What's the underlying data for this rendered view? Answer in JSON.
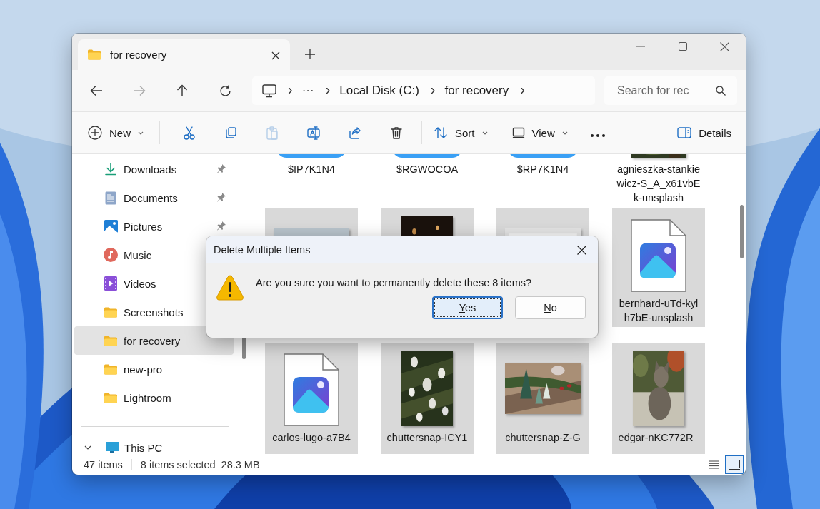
{
  "tab": {
    "title": "for recovery",
    "selected": true
  },
  "address": {
    "items": [
      {
        "kind": "separator",
        "text": "›"
      },
      {
        "kind": "crumb",
        "text": "···"
      },
      {
        "kind": "separator",
        "text": "›"
      },
      {
        "kind": "crumb",
        "text": "Local Disk (C:)"
      },
      {
        "kind": "separator",
        "text": "›"
      },
      {
        "kind": "crumb",
        "text": "for recovery"
      },
      {
        "kind": "separator",
        "text": "›"
      }
    ]
  },
  "search": {
    "placeholder": "Search for rec"
  },
  "toolbar": {
    "new": {
      "label": "New"
    },
    "actions": [
      {
        "disabled": false
      },
      {
        "disabled": false
      },
      {
        "disabled": true
      },
      {
        "disabled": false
      },
      {
        "disabled": false
      },
      {
        "disabled": false
      }
    ],
    "menus": [
      {
        "label": "Sort"
      },
      {
        "label": "View"
      }
    ],
    "details": {
      "label": "Details"
    }
  },
  "sidebar": {
    "items": [
      {
        "label": "Downloads",
        "pinned": true,
        "selected": false
      },
      {
        "label": "Documents",
        "pinned": true,
        "selected": false
      },
      {
        "label": "Pictures",
        "pinned": true,
        "selected": false
      },
      {
        "label": "Music",
        "pinned": false,
        "selected": false
      },
      {
        "label": "Videos",
        "pinned": false,
        "selected": false
      },
      {
        "label": "Screenshots",
        "pinned": false,
        "selected": false
      },
      {
        "label": "for recovery",
        "pinned": false,
        "selected": true
      },
      {
        "label": "new-pro",
        "pinned": false,
        "selected": false
      },
      {
        "label": "Lightroom",
        "pinned": false,
        "selected": false
      }
    ],
    "this_pc": {
      "label": "This PC",
      "expanded": true
    }
  },
  "files": [
    {
      "kind": "app",
      "name": "$IP7K1N4",
      "selected": false
    },
    {
      "kind": "app",
      "name": "$RGWOCOA",
      "selected": false
    },
    {
      "kind": "app",
      "name": "$RP7K1N4",
      "selected": false
    },
    {
      "kind": "picture",
      "name": "agnieszka-stankiewicz-S_A_x61vbEk-unsplash",
      "selected": false
    },
    {
      "kind": "picture",
      "selected": true
    },
    {
      "kind": "picture",
      "selected": true
    },
    {
      "kind": "picture",
      "selected": true
    },
    {
      "kind": "image-file",
      "name": "bernhard-uTd-kylh7bE-unsplash",
      "selected": true
    },
    {
      "kind": "image-file",
      "name": "carlos-lugo-a7B4",
      "selected": true
    },
    {
      "kind": "picture",
      "name": "chuttersnap-ICY1",
      "selected": true
    },
    {
      "kind": "picture",
      "name": "chuttersnap-Z-G",
      "selected": true
    },
    {
      "kind": "picture",
      "name": "edgar-nKC772R_",
      "selected": true
    }
  ],
  "status": {
    "count": "47 items",
    "selection": "8 items selected",
    "size": "28.3 MB",
    "views": [
      {
        "selected": false
      },
      {
        "selected": true
      }
    ]
  },
  "dialog": {
    "title": "Delete Multiple Items",
    "message": "Are you sure you want to permanently delete these 8 items?",
    "buttons": [
      {
        "label": "Yes",
        "default": true
      },
      {
        "label": "No",
        "default": false
      }
    ]
  }
}
